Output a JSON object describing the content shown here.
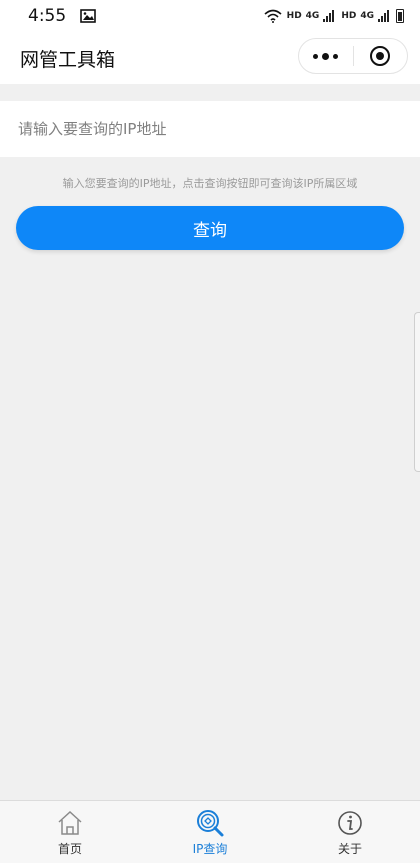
{
  "status_bar": {
    "time": "4:55",
    "hd1": "HD",
    "net1": "4G",
    "hd2": "HD",
    "net2": "4G"
  },
  "nav": {
    "title": "网管工具箱",
    "more_icon": "more-dots-icon",
    "close_icon": "target-icon"
  },
  "search": {
    "value": "",
    "placeholder": "请输入要查询的IP地址"
  },
  "hint": "输入您要查询的IP地址，点击查询按钮即可查询该IP所属区域",
  "query_label": "查询",
  "tabs": [
    {
      "label": "首页",
      "icon": "home-icon",
      "active": false
    },
    {
      "label": "IP查询",
      "icon": "ip-search-icon",
      "active": true
    },
    {
      "label": "关于",
      "icon": "info-icon",
      "active": false
    }
  ],
  "colors": {
    "primary": "#0e87f8",
    "tab_active": "#1b7fd8",
    "background": "#f0f0f0"
  }
}
